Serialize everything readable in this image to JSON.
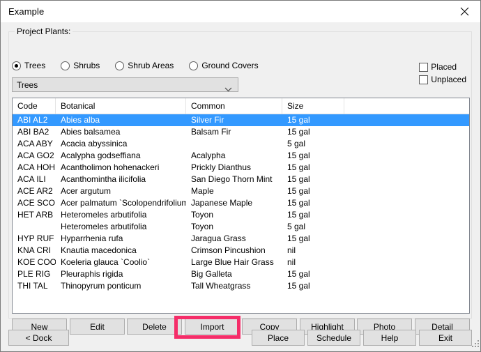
{
  "window": {
    "title": "Example",
    "close_icon": "close-icon"
  },
  "groupbox": {
    "label": "Project Plants:"
  },
  "radios": [
    {
      "label": "Trees",
      "checked": true
    },
    {
      "label": "Shrubs",
      "checked": false
    },
    {
      "label": "Shrub Areas",
      "checked": false
    },
    {
      "label": "Ground Covers",
      "checked": false
    }
  ],
  "combo": {
    "value": "Trees",
    "arrow_icon": "chevron-down-icon"
  },
  "checkboxes": [
    {
      "label": "Placed",
      "checked": false
    },
    {
      "label": "Unplaced",
      "checked": false
    }
  ],
  "listview": {
    "columns": [
      "Code",
      "Botanical",
      "Common",
      "Size"
    ],
    "selected_index": 0,
    "rows": [
      {
        "code": "ABI AL2",
        "botanical": "Abies alba",
        "common": "Silver Fir",
        "size": "15 gal"
      },
      {
        "code": "ABI BA2",
        "botanical": "Abies balsamea",
        "common": "Balsam Fir",
        "size": "15 gal"
      },
      {
        "code": "ACA ABY",
        "botanical": "Acacia abyssinica",
        "common": "",
        "size": "5 gal"
      },
      {
        "code": "ACA GO2",
        "botanical": "Acalypha godseffiana",
        "common": "Acalypha",
        "size": "15 gal"
      },
      {
        "code": "ACA HOH",
        "botanical": "Acantholimon hohenackeri",
        "common": "Prickly Dianthus",
        "size": "15 gal"
      },
      {
        "code": "ACA ILI",
        "botanical": "Acanthomintha ilicifolia",
        "common": "San Diego Thorn Mint",
        "size": "15 gal"
      },
      {
        "code": "ACE AR2",
        "botanical": "Acer argutum",
        "common": "Maple",
        "size": "15 gal"
      },
      {
        "code": "ACE SCO",
        "botanical": "Acer palmatum `Scolopendrifolium`",
        "common": "Japanese Maple",
        "size": "15 gal"
      },
      {
        "code": "HET ARB",
        "botanical": "Heteromeles arbutifolia",
        "common": "Toyon",
        "size": "15 gal"
      },
      {
        "code": "",
        "botanical": "Heteromeles arbutifolia",
        "common": "Toyon",
        "size": "5 gal"
      },
      {
        "code": "HYP RUF",
        "botanical": "Hyparrhenia rufa",
        "common": "Jaragua Grass",
        "size": "15 gal"
      },
      {
        "code": "KNA CRI",
        "botanical": "Knautia macedonica",
        "common": "Crimson Pincushion",
        "size": "nil"
      },
      {
        "code": "KOE COO",
        "botanical": "Koeleria glauca `Coolio`",
        "common": "Large Blue Hair Grass",
        "size": "nil"
      },
      {
        "code": "PLE RIG",
        "botanical": "Pleuraphis rigida",
        "common": "Big Galleta",
        "size": "15 gal"
      },
      {
        "code": "THI TAL",
        "botanical": "Thinopyrum  ponticum",
        "common": "Tall Wheatgrass",
        "size": "15 gal"
      }
    ]
  },
  "action_buttons": [
    "New",
    "Edit",
    "Delete",
    "Import",
    "Copy",
    "Highlight",
    "Photo",
    "Detail"
  ],
  "dock_button": "< Dock",
  "bottom_buttons": [
    "Place",
    "Schedule",
    "Help",
    "Exit"
  ],
  "highlight": {
    "target": "Import",
    "color": "#f52d69"
  },
  "colors": {
    "selection": "#3399ff",
    "button_face": "#e1e1e1",
    "dialog_face": "#f0f0f0"
  }
}
